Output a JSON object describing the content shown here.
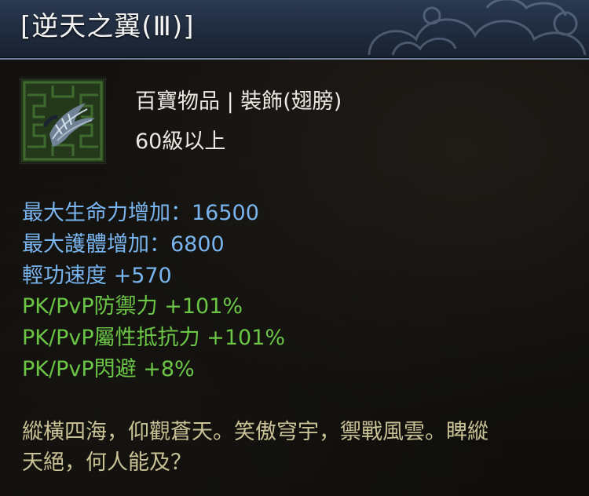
{
  "item": {
    "name": "[逆天之翼(Ⅲ)]",
    "category": "百寶物品 | 裝飾(翅膀)",
    "requirement": "60級以上",
    "icon": "wing-item-icon"
  },
  "stats": [
    {
      "text": "最大生命力增加：16500",
      "color": "#79b4ee"
    },
    {
      "text": "最大護體增加：6800",
      "color": "#79b4ee"
    },
    {
      "text": "輕功速度 +570",
      "color": "#79b4ee"
    },
    {
      "text": "PK/PvP防禦力 +101%",
      "color": "#6bc646"
    },
    {
      "text": "PK/PvP屬性抵抗力 +101%",
      "color": "#6bc646"
    },
    {
      "text": "PK/PvP閃避 +8%",
      "color": "#6bc646"
    }
  ],
  "flavor": [
    "縱橫四海，仰觀蒼天。笑傲穹宇，禦戰風雲。睥縱",
    "天絕，何人能及？"
  ],
  "colors": {
    "title_bar": "#1f2b3e",
    "stat_blue": "#79b4ee",
    "stat_green": "#6bc646",
    "flavor": "#c9c296"
  }
}
